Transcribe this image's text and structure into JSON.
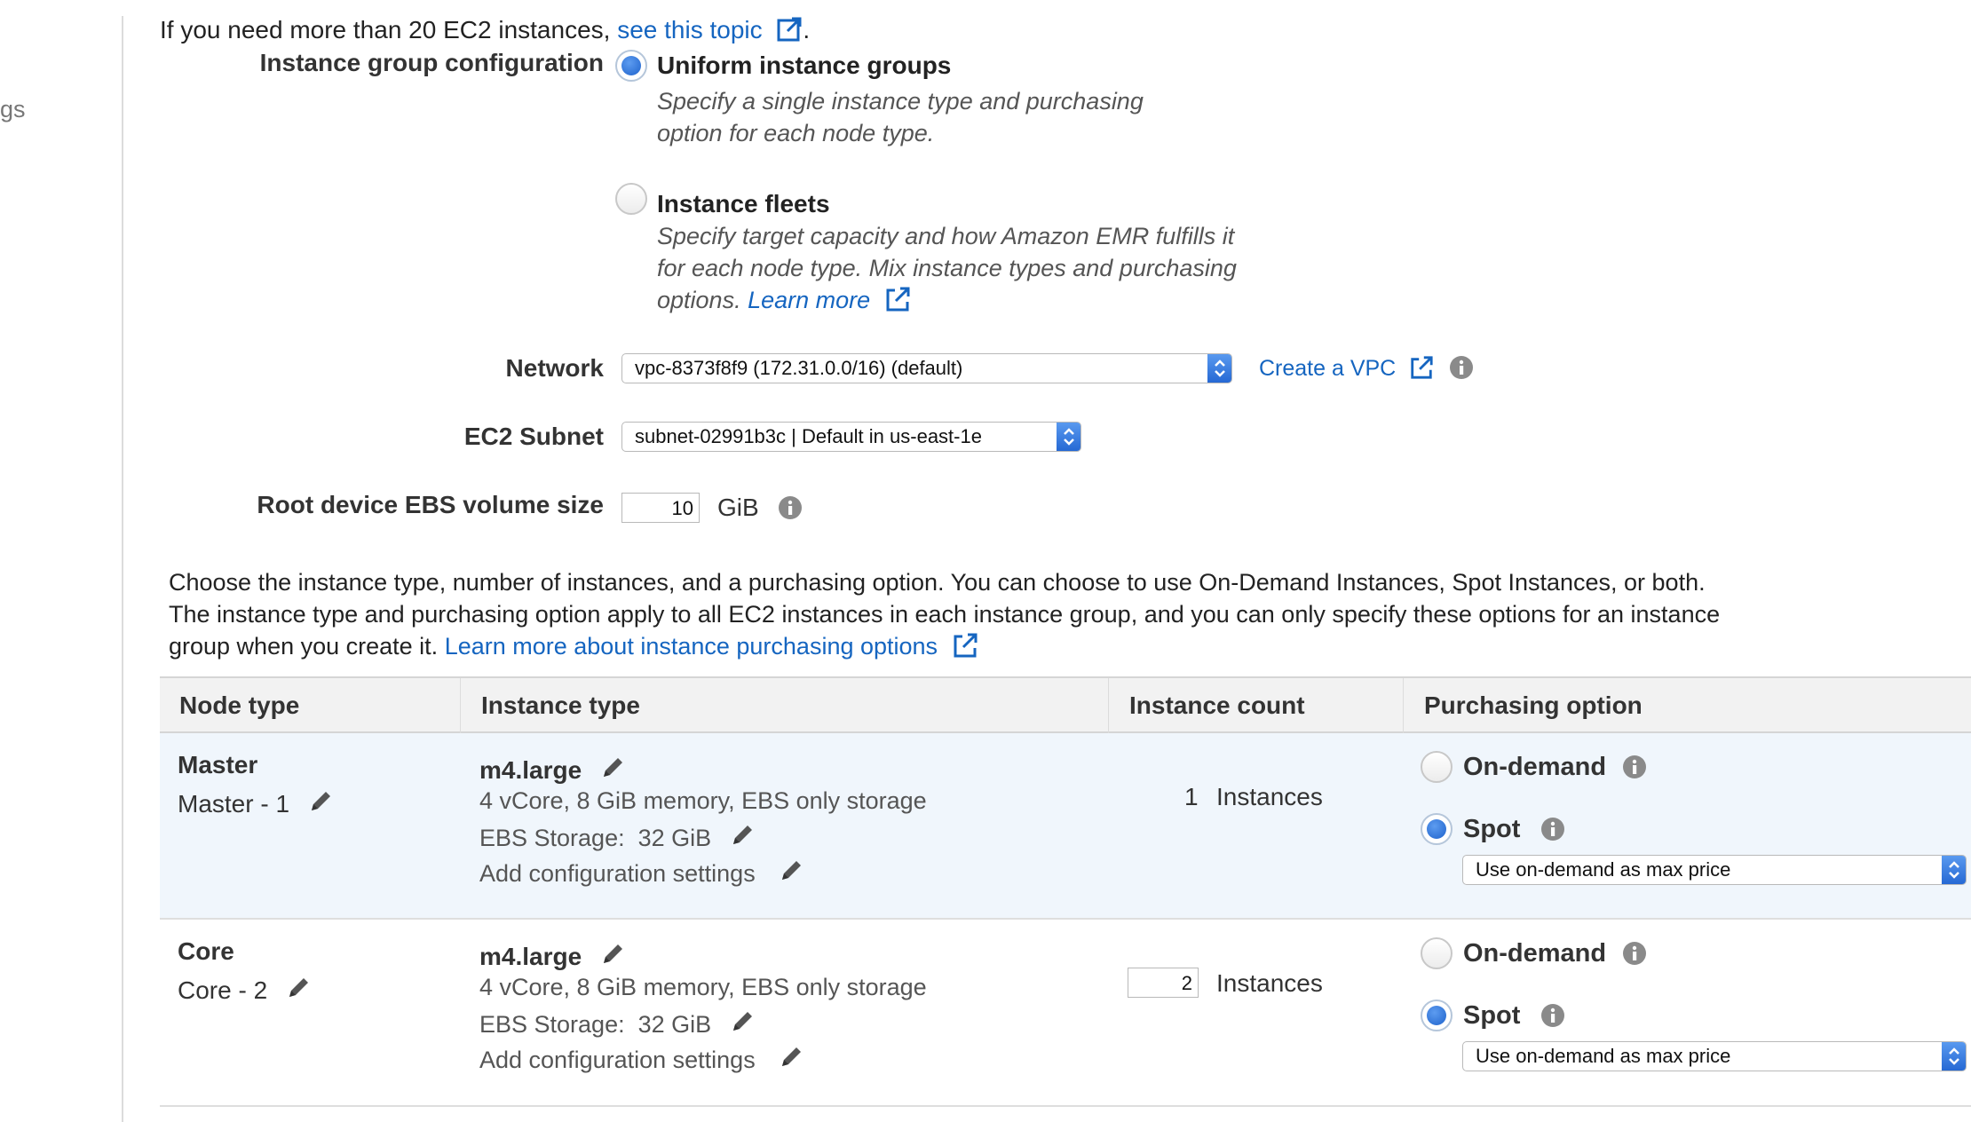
{
  "left_nav": {
    "fragment": "gs"
  },
  "intro": {
    "text": "If you need more than 20 EC2 instances, ",
    "link": "see this topic",
    "after": "."
  },
  "instance_group_config": {
    "label": "Instance group configuration",
    "options": [
      {
        "title": "Uniform instance groups",
        "description": "Specify a single instance type and purchasing option for each node type.",
        "selected": true
      },
      {
        "title": "Instance fleets",
        "description": "Specify target capacity and how Amazon EMR fulfills it for each node type. Mix instance types and purchasing options.",
        "learn_more": "Learn more",
        "selected": false
      }
    ]
  },
  "network": {
    "label": "Network",
    "value": "vpc-8373f8f9 (172.31.0.0/16) (default)",
    "create_link": "Create a VPC"
  },
  "subnet": {
    "label": "EC2 Subnet",
    "value": "subnet-02991b3c | Default in us-east-1e"
  },
  "root_volume": {
    "label": "Root device EBS volume size",
    "value": "10",
    "unit": "GiB"
  },
  "purchasing_info": {
    "line1": "Choose the instance type, number of instances, and a purchasing option. You can choose to use On-Demand Instances, Spot Instances, or both.",
    "line2": "The instance type and purchasing option apply to all EC2 instances in each instance group, and you can only specify these options for an instance",
    "line3": "group when you create it. ",
    "link": "Learn more about instance purchasing options"
  },
  "table": {
    "headers": [
      "Node type",
      "Instance type",
      "Instance count",
      "Purchasing option"
    ],
    "rows": [
      {
        "node_type": "Master",
        "node_name": "Master - 1",
        "instance_type": "m4.large",
        "specs": "4 vCore, 8 GiB memory, EBS only storage",
        "ebs_storage": "EBS Storage:  32 GiB",
        "config": "Add configuration settings",
        "count": "1",
        "count_unit": "Instances",
        "on_demand": "On-demand",
        "spot": "Spot",
        "spot_selected": true,
        "max_price": "Use on-demand as max price"
      },
      {
        "node_type": "Core",
        "node_name": "Core - 2",
        "instance_type": "m4.large",
        "specs": "4 vCore, 8 GiB memory, EBS only storage",
        "ebs_storage": "EBS Storage:  32 GiB",
        "config": "Add configuration settings",
        "count": "2",
        "count_unit": "Instances",
        "on_demand": "On-demand",
        "spot": "Spot",
        "spot_selected": true,
        "max_price": "Use on-demand as max price"
      }
    ]
  },
  "colors": {
    "link": "#1565c0",
    "radio_selected": "#2467d3",
    "row_highlight": "#f0f6fc",
    "header_bg": "#f2f2f2"
  }
}
